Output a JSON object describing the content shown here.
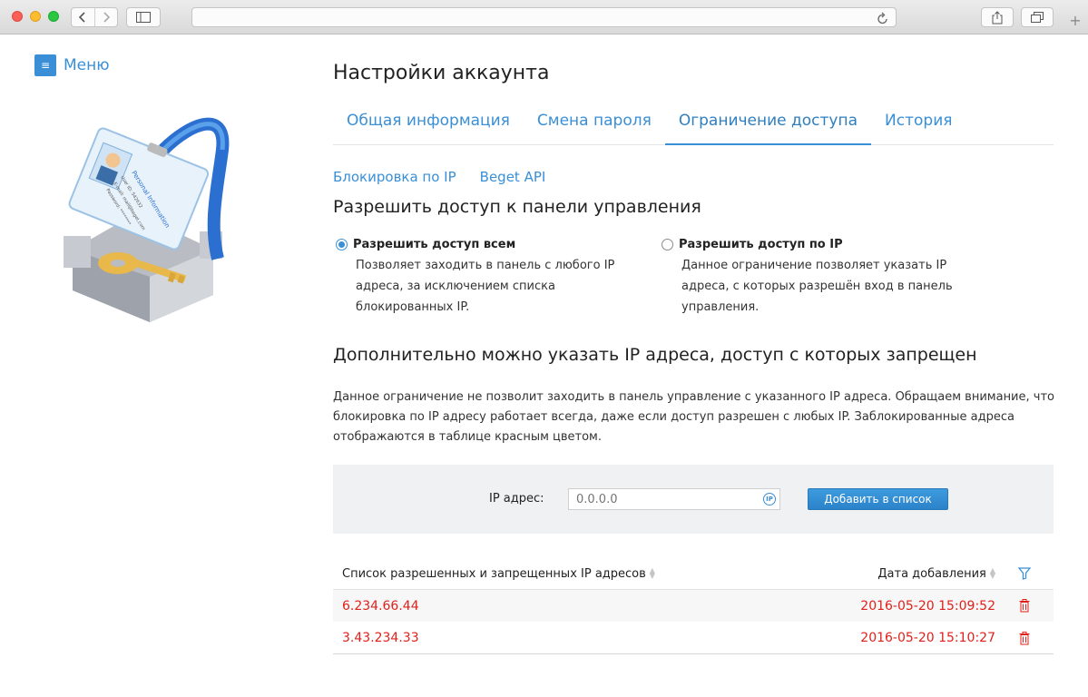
{
  "menu": {
    "label": "Меню"
  },
  "page": {
    "title": "Настройки аккаунта"
  },
  "tabs": [
    {
      "label": "Общая информация",
      "active": false
    },
    {
      "label": "Смена пароля",
      "active": false
    },
    {
      "label": "Ограничение доступа",
      "active": true
    },
    {
      "label": "История",
      "active": false
    }
  ],
  "subtabs": [
    {
      "label": "Блокировка по IP"
    },
    {
      "label": "Beget API"
    }
  ],
  "section1": {
    "heading": "Разрешить доступ к панели управления"
  },
  "options": [
    {
      "label": "Разрешить доступ всем",
      "selected": true,
      "desc": "Позволяет заходить в панель с любого IP адреса, за исключением списка блокированных IP."
    },
    {
      "label": "Разрешить доступ по IP",
      "selected": false,
      "desc": "Данное ограничение позволяет указать IP адреса, с которых разрешён вход в панель управления."
    }
  ],
  "section2": {
    "heading": "Дополнительно можно указать IP адреса, доступ с которых запрещен",
    "text": "Данное ограничение не позволит заходить в панель управление с указанного IP адреса. Обращаем внимание, что блокировка по IP адресу работает всегда, даже если доступ разрешен с любых IP. Заблокированные адреса отображаются в таблице красным цветом."
  },
  "ip_form": {
    "label": "IP адрес:",
    "placeholder": "0.0.0.0",
    "badge": "IP",
    "button": "Добавить в список"
  },
  "table": {
    "col_ip": "Список разрешенных и запрещенных IP адресов",
    "col_date": "Дата добавления",
    "rows": [
      {
        "ip": "6.234.66.44",
        "date": "2016-05-20 15:09:52",
        "blocked": true
      },
      {
        "ip": "3.43.234.33",
        "date": "2016-05-20 15:10:27",
        "blocked": true
      }
    ]
  },
  "illustration_card": {
    "title": "Personal Information",
    "user_id": "User ID: 542632",
    "email": "E-mail: mail@beget.com",
    "password": "Password: ********"
  },
  "colors": {
    "accent": "#3a8fd6",
    "blocked": "#e0211b",
    "panel_bg": "#eff1f3"
  },
  "icons": [
    "back-icon",
    "forward-icon",
    "sidebar-icon",
    "reload-icon",
    "share-icon",
    "tabs-icon",
    "new-tab-icon",
    "menu-icon",
    "filter-icon",
    "trash-icon",
    "ip-badge-icon"
  ]
}
